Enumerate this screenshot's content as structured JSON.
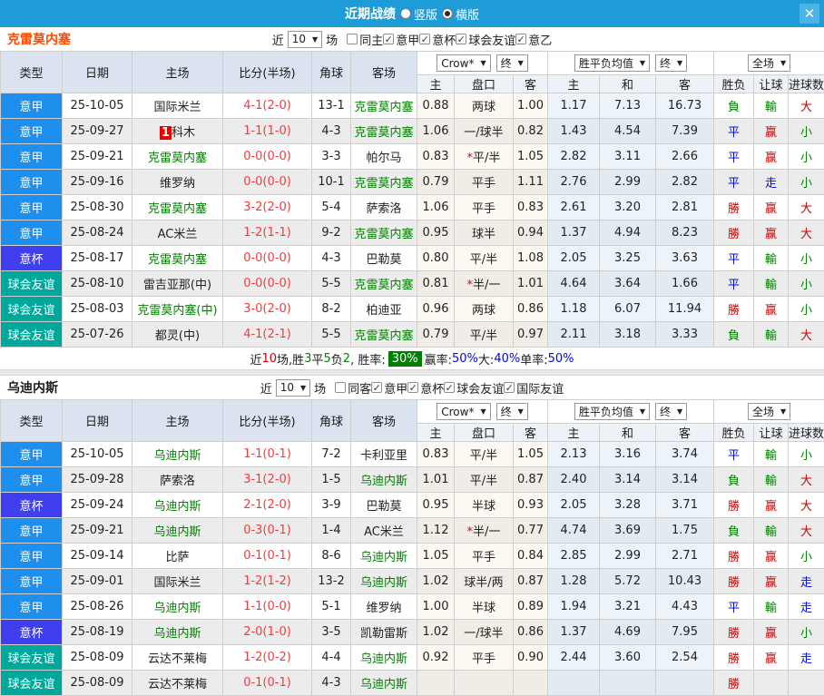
{
  "titlebar": {
    "title": "近期战绩",
    "close": "✕",
    "radios": [
      {
        "label": "竖版",
        "selected": false
      },
      {
        "label": "横版",
        "selected": true
      }
    ]
  },
  "filter_words": {
    "near": "近",
    "games": "场"
  },
  "selects": {
    "near_count": "10",
    "bookmaker": "Crow*",
    "final_a": "终",
    "avg": "胜平负均值",
    "final_b": "终",
    "scope": "全场"
  },
  "columns": {
    "type": "类型",
    "date": "日期",
    "home": "主场",
    "score": "比分(半场)",
    "corner": "角球",
    "away": "客场",
    "o_home": "主",
    "o_line": "盘口",
    "o_away": "客",
    "a_home": "主",
    "a_draw": "和",
    "a_away": "客",
    "wdl": "胜负",
    "handicap": "让球",
    "goals": "进球数"
  },
  "type_colors": {
    "意甲": "#1f8fee",
    "意杯": "#3f3ff0",
    "球会友谊": "#00a79b"
  },
  "sections": [
    {
      "team": "克雷莫内塞",
      "team_color": "#ff4a00",
      "checkboxes": [
        {
          "label": "同主",
          "checked": false
        },
        {
          "label": "意甲",
          "checked": true
        },
        {
          "label": "意杯",
          "checked": true
        },
        {
          "label": "球会友谊",
          "checked": true
        },
        {
          "label": "意乙",
          "checked": true
        }
      ],
      "rows": [
        {
          "lg": "意甲",
          "dt": "25-10-05",
          "hm": "国际米兰",
          "hmG": false,
          "hmBadge": "",
          "sc": "4-1(2-0)",
          "cn": "13-1",
          "aw": "克雷莫内塞",
          "awG": true,
          "o1": "0.88",
          "ln": "两球",
          "lnS": false,
          "o2": "1.00",
          "m1": "1.17",
          "m2": "7.13",
          "m3": "16.73",
          "r1": "負",
          "c1": "g",
          "r2": "輸",
          "c2": "g",
          "r3": "大",
          "c3": "r"
        },
        {
          "lg": "意甲",
          "dt": "25-09-27",
          "hm": "科木",
          "hmG": false,
          "hmBadge": "1",
          "sc": "1-1(1-0)",
          "cn": "4-3",
          "aw": "克雷莫内塞",
          "awG": true,
          "o1": "1.06",
          "ln": "一/球半",
          "lnS": false,
          "o2": "0.82",
          "m1": "1.43",
          "m2": "4.54",
          "m3": "7.39",
          "r1": "平",
          "c1": "b",
          "r2": "赢",
          "c2": "r",
          "r3": "小",
          "c3": "g"
        },
        {
          "lg": "意甲",
          "dt": "25-09-21",
          "hm": "克雷莫内塞",
          "hmG": true,
          "hmBadge": "",
          "sc": "0-0(0-0)",
          "cn": "3-3",
          "aw": "帕尔马",
          "awG": false,
          "o1": "0.83",
          "ln": "平/半",
          "lnS": true,
          "o2": "1.05",
          "m1": "2.82",
          "m2": "3.11",
          "m3": "2.66",
          "r1": "平",
          "c1": "b",
          "r2": "赢",
          "c2": "r",
          "r3": "小",
          "c3": "g"
        },
        {
          "lg": "意甲",
          "dt": "25-09-16",
          "hm": "维罗纳",
          "hmG": false,
          "hmBadge": "",
          "sc": "0-0(0-0)",
          "cn": "10-1",
          "aw": "克雷莫内塞",
          "awG": true,
          "o1": "0.79",
          "ln": "平手",
          "lnS": false,
          "o2": "1.11",
          "m1": "2.76",
          "m2": "2.99",
          "m3": "2.82",
          "r1": "平",
          "c1": "b",
          "r2": "走",
          "c2": "b",
          "r3": "小",
          "c3": "g"
        },
        {
          "lg": "意甲",
          "dt": "25-08-30",
          "hm": "克雷莫内塞",
          "hmG": true,
          "hmBadge": "",
          "sc": "3-2(2-0)",
          "cn": "5-4",
          "aw": "萨索洛",
          "awG": false,
          "o1": "1.06",
          "ln": "平手",
          "lnS": false,
          "o2": "0.83",
          "m1": "2.61",
          "m2": "3.20",
          "m3": "2.81",
          "r1": "勝",
          "c1": "r",
          "r2": "赢",
          "c2": "r",
          "r3": "大",
          "c3": "r"
        },
        {
          "lg": "意甲",
          "dt": "25-08-24",
          "hm": "AC米兰",
          "hmG": false,
          "hmBadge": "",
          "sc": "1-2(1-1)",
          "cn": "9-2",
          "aw": "克雷莫内塞",
          "awG": true,
          "o1": "0.95",
          "ln": "球半",
          "lnS": false,
          "o2": "0.94",
          "m1": "1.37",
          "m2": "4.94",
          "m3": "8.23",
          "r1": "勝",
          "c1": "r",
          "r2": "赢",
          "c2": "r",
          "r3": "大",
          "c3": "r"
        },
        {
          "lg": "意杯",
          "dt": "25-08-17",
          "hm": "克雷莫内塞",
          "hmG": true,
          "hmBadge": "",
          "sc": "0-0(0-0)",
          "cn": "4-3",
          "aw": "巴勒莫",
          "awG": false,
          "o1": "0.80",
          "ln": "平/半",
          "lnS": false,
          "o2": "1.08",
          "m1": "2.05",
          "m2": "3.25",
          "m3": "3.63",
          "r1": "平",
          "c1": "b",
          "r2": "輸",
          "c2": "g",
          "r3": "小",
          "c3": "g"
        },
        {
          "lg": "球会友谊",
          "dt": "25-08-10",
          "hm": "雷吉亚那(中)",
          "hmG": false,
          "hmBadge": "",
          "sc": "0-0(0-0)",
          "cn": "5-5",
          "aw": "克雷莫内塞",
          "awG": true,
          "o1": "0.81",
          "ln": "半/一",
          "lnS": true,
          "o2": "1.01",
          "m1": "4.64",
          "m2": "3.64",
          "m3": "1.66",
          "r1": "平",
          "c1": "b",
          "r2": "輸",
          "c2": "g",
          "r3": "小",
          "c3": "g"
        },
        {
          "lg": "球会友谊",
          "dt": "25-08-03",
          "hm": "克雷莫内塞(中)",
          "hmG": true,
          "hmBadge": "",
          "sc": "3-0(2-0)",
          "cn": "8-2",
          "aw": "柏迪亚",
          "awG": false,
          "o1": "0.96",
          "ln": "两球",
          "lnS": false,
          "o2": "0.86",
          "m1": "1.18",
          "m2": "6.07",
          "m3": "11.94",
          "r1": "勝",
          "c1": "r",
          "r2": "赢",
          "c2": "r",
          "r3": "小",
          "c3": "g"
        },
        {
          "lg": "球会友谊",
          "dt": "25-07-26",
          "hm": "都灵(中)",
          "hmG": false,
          "hmBadge": "",
          "sc": "4-1(2-1)",
          "cn": "5-5",
          "aw": "克雷莫内塞",
          "awG": true,
          "o1": "0.79",
          "ln": "平/半",
          "lnS": false,
          "o2": "0.97",
          "m1": "2.11",
          "m2": "3.18",
          "m3": "3.33",
          "r1": "負",
          "c1": "g",
          "r2": "輸",
          "c2": "g",
          "r3": "大",
          "c3": "r"
        }
      ],
      "summary": [
        {
          "t": "近",
          "c": "k"
        },
        {
          "t": "10",
          "c": "r"
        },
        {
          "t": "场,胜",
          "c": "k"
        },
        {
          "t": "3",
          "c": "g"
        },
        {
          "t": "平",
          "c": "k"
        },
        {
          "t": "5",
          "c": "g"
        },
        {
          "t": "负",
          "c": "k"
        },
        {
          "t": "2",
          "c": "g"
        },
        {
          "t": ", 胜率:",
          "c": "k"
        },
        {
          "t": "30%",
          "c": "badge"
        },
        {
          "t": " 赢率:",
          "c": "k"
        },
        {
          "t": "50%",
          "c": "b"
        },
        {
          "t": " 大:",
          "c": "k"
        },
        {
          "t": "40%",
          "c": "b"
        },
        {
          "t": " 单率:",
          "c": "k"
        },
        {
          "t": "50%",
          "c": "b"
        }
      ]
    },
    {
      "team": "乌迪内斯",
      "team_color": "#1c1c1c",
      "checkboxes": [
        {
          "label": "同客",
          "checked": false
        },
        {
          "label": "意甲",
          "checked": true
        },
        {
          "label": "意杯",
          "checked": true
        },
        {
          "label": "球会友谊",
          "checked": true
        },
        {
          "label": "国际友谊",
          "checked": true
        }
      ],
      "rows": [
        {
          "lg": "意甲",
          "dt": "25-10-05",
          "hm": "乌迪内斯",
          "hmG": true,
          "hmBadge": "",
          "sc": "1-1(0-1)",
          "cn": "7-2",
          "aw": "卡利亚里",
          "awG": false,
          "o1": "0.83",
          "ln": "平/半",
          "lnS": false,
          "o2": "1.05",
          "m1": "2.13",
          "m2": "3.16",
          "m3": "3.74",
          "r1": "平",
          "c1": "b",
          "r2": "輸",
          "c2": "g",
          "r3": "小",
          "c3": "g"
        },
        {
          "lg": "意甲",
          "dt": "25-09-28",
          "hm": "萨索洛",
          "hmG": false,
          "hmBadge": "",
          "sc": "3-1(2-0)",
          "cn": "1-5",
          "aw": "乌迪内斯",
          "awG": true,
          "o1": "1.01",
          "ln": "平/半",
          "lnS": false,
          "o2": "0.87",
          "m1": "2.40",
          "m2": "3.14",
          "m3": "3.14",
          "r1": "負",
          "c1": "g",
          "r2": "輸",
          "c2": "g",
          "r3": "大",
          "c3": "r"
        },
        {
          "lg": "意杯",
          "dt": "25-09-24",
          "hm": "乌迪内斯",
          "hmG": true,
          "hmBadge": "",
          "sc": "2-1(2-0)",
          "cn": "3-9",
          "aw": "巴勒莫",
          "awG": false,
          "o1": "0.95",
          "ln": "半球",
          "lnS": false,
          "o2": "0.93",
          "m1": "2.05",
          "m2": "3.28",
          "m3": "3.71",
          "r1": "勝",
          "c1": "r",
          "r2": "赢",
          "c2": "r",
          "r3": "大",
          "c3": "r"
        },
        {
          "lg": "意甲",
          "dt": "25-09-21",
          "hm": "乌迪内斯",
          "hmG": true,
          "hmBadge": "",
          "sc": "0-3(0-1)",
          "cn": "1-4",
          "aw": "AC米兰",
          "awG": false,
          "o1": "1.12",
          "ln": "半/一",
          "lnS": true,
          "o2": "0.77",
          "m1": "4.74",
          "m2": "3.69",
          "m3": "1.75",
          "r1": "負",
          "c1": "g",
          "r2": "輸",
          "c2": "g",
          "r3": "大",
          "c3": "r"
        },
        {
          "lg": "意甲",
          "dt": "25-09-14",
          "hm": "比萨",
          "hmG": false,
          "hmBadge": "",
          "sc": "0-1(0-1)",
          "cn": "8-6",
          "aw": "乌迪内斯",
          "awG": true,
          "o1": "1.05",
          "ln": "平手",
          "lnS": false,
          "o2": "0.84",
          "m1": "2.85",
          "m2": "2.99",
          "m3": "2.71",
          "r1": "勝",
          "c1": "r",
          "r2": "赢",
          "c2": "r",
          "r3": "小",
          "c3": "g"
        },
        {
          "lg": "意甲",
          "dt": "25-09-01",
          "hm": "国际米兰",
          "hmG": false,
          "hmBadge": "",
          "sc": "1-2(1-2)",
          "cn": "13-2",
          "aw": "乌迪内斯",
          "awG": true,
          "o1": "1.02",
          "ln": "球半/两",
          "lnS": false,
          "o2": "0.87",
          "m1": "1.28",
          "m2": "5.72",
          "m3": "10.43",
          "r1": "勝",
          "c1": "r",
          "r2": "赢",
          "c2": "r",
          "r3": "走",
          "c3": "b"
        },
        {
          "lg": "意甲",
          "dt": "25-08-26",
          "hm": "乌迪内斯",
          "hmG": true,
          "hmBadge": "",
          "sc": "1-1(0-0)",
          "cn": "5-1",
          "aw": "维罗纳",
          "awG": false,
          "o1": "1.00",
          "ln": "半球",
          "lnS": false,
          "o2": "0.89",
          "m1": "1.94",
          "m2": "3.21",
          "m3": "4.43",
          "r1": "平",
          "c1": "b",
          "r2": "輸",
          "c2": "g",
          "r3": "走",
          "c3": "b"
        },
        {
          "lg": "意杯",
          "dt": "25-08-19",
          "hm": "乌迪内斯",
          "hmG": true,
          "hmBadge": "",
          "sc": "2-0(1-0)",
          "cn": "3-5",
          "aw": "凯勒雷斯",
          "awG": false,
          "o1": "1.02",
          "ln": "一/球半",
          "lnS": false,
          "o2": "0.86",
          "m1": "1.37",
          "m2": "4.69",
          "m3": "7.95",
          "r1": "勝",
          "c1": "r",
          "r2": "赢",
          "c2": "r",
          "r3": "小",
          "c3": "g"
        },
        {
          "lg": "球会友谊",
          "dt": "25-08-09",
          "hm": "云达不莱梅",
          "hmG": false,
          "hmBadge": "",
          "sc": "1-2(0-2)",
          "cn": "4-4",
          "aw": "乌迪内斯",
          "awG": true,
          "o1": "0.92",
          "ln": "平手",
          "lnS": false,
          "o2": "0.90",
          "m1": "2.44",
          "m2": "3.60",
          "m3": "2.54",
          "r1": "勝",
          "c1": "r",
          "r2": "赢",
          "c2": "r",
          "r3": "走",
          "c3": "b"
        },
        {
          "lg": "球会友谊",
          "dt": "25-08-09",
          "hm": "云达不莱梅",
          "hmG": false,
          "hmBadge": "",
          "sc": "0-1(0-1)",
          "cn": "4-3",
          "aw": "乌迪内斯",
          "awG": true,
          "o1": "",
          "ln": "",
          "lnS": false,
          "o2": "",
          "m1": "",
          "m2": "",
          "m3": "",
          "r1": "勝",
          "c1": "r",
          "r2": "",
          "c2": "k",
          "r3": "",
          "c3": "k"
        }
      ],
      "summary": null
    }
  ]
}
